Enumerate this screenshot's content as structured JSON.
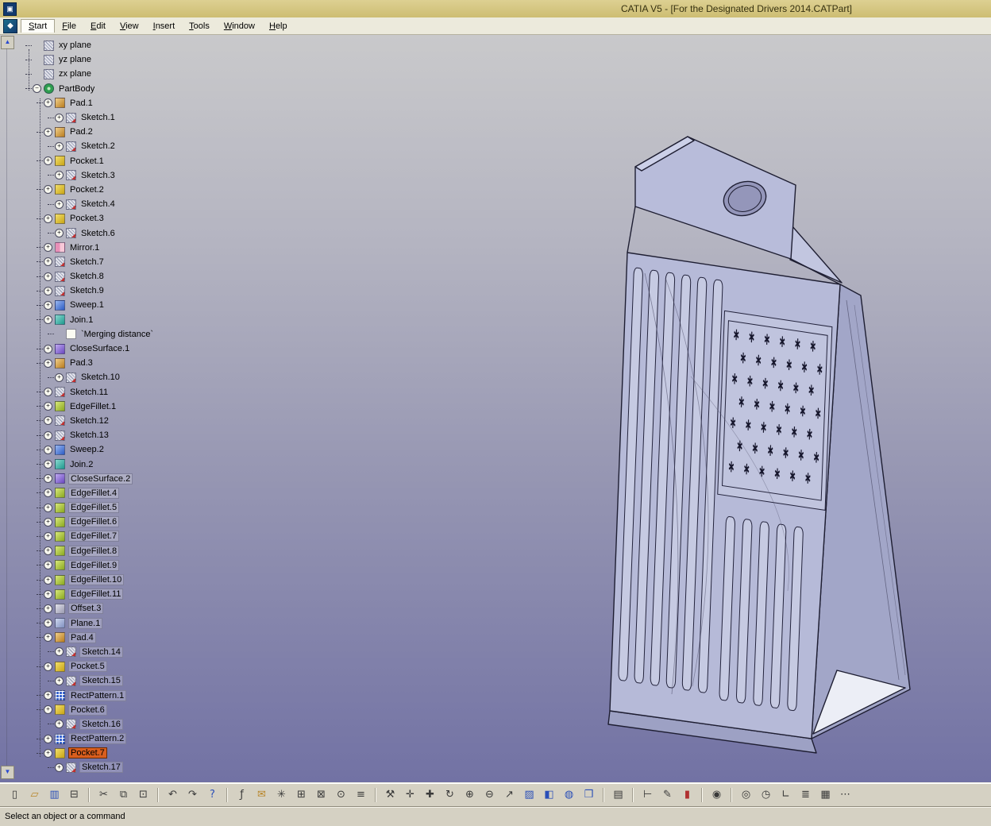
{
  "window": {
    "title": "CATIA V5 - [For the Designated Drivers 2014.CATPart]"
  },
  "menu": {
    "items": [
      "Start",
      "File",
      "Edit",
      "View",
      "Insert",
      "Tools",
      "Window",
      "Help"
    ]
  },
  "status": {
    "message": "Select an object or a command"
  },
  "colors": {
    "selection": "#d95e1e",
    "titlebar": "#d4c87e",
    "viewport_top": "#c9c9cb",
    "viewport_bottom": "#7272a4",
    "model_fill": "#b6bad8"
  },
  "tree": {
    "items": [
      {
        "label": "xy plane",
        "icon": "plane",
        "level": 1,
        "toggle": "",
        "state": ""
      },
      {
        "label": "yz plane",
        "icon": "plane",
        "level": 1,
        "toggle": "",
        "state": ""
      },
      {
        "label": "zx plane",
        "icon": "plane",
        "level": 1,
        "toggle": "",
        "state": ""
      },
      {
        "label": "PartBody",
        "icon": "partbody",
        "level": 1,
        "toggle": "-",
        "state": ""
      },
      {
        "label": "Pad.1",
        "icon": "pad",
        "level": 2,
        "toggle": "+",
        "state": ""
      },
      {
        "label": "Sketch.1",
        "icon": "sketch",
        "level": 3,
        "toggle": "+",
        "state": ""
      },
      {
        "label": "Pad.2",
        "icon": "pad",
        "level": 2,
        "toggle": "+",
        "state": ""
      },
      {
        "label": "Sketch.2",
        "icon": "sketch",
        "level": 3,
        "toggle": "+",
        "state": ""
      },
      {
        "label": "Pocket.1",
        "icon": "pocket",
        "level": 2,
        "toggle": "+",
        "state": ""
      },
      {
        "label": "Sketch.3",
        "icon": "sketch",
        "level": 3,
        "toggle": "+",
        "state": ""
      },
      {
        "label": "Pocket.2",
        "icon": "pocket",
        "level": 2,
        "toggle": "+",
        "state": ""
      },
      {
        "label": "Sketch.4",
        "icon": "sketch",
        "level": 3,
        "toggle": "+",
        "state": ""
      },
      {
        "label": "Pocket.3",
        "icon": "pocket",
        "level": 2,
        "toggle": "+",
        "state": ""
      },
      {
        "label": "Sketch.6",
        "icon": "sketch",
        "level": 3,
        "toggle": "+",
        "state": ""
      },
      {
        "label": "Mirror.1",
        "icon": "mirror",
        "level": 2,
        "toggle": "+",
        "state": ""
      },
      {
        "label": "Sketch.7",
        "icon": "sketch",
        "level": 2,
        "toggle": "+",
        "state": ""
      },
      {
        "label": "Sketch.8",
        "icon": "sketch",
        "level": 2,
        "toggle": "+",
        "state": ""
      },
      {
        "label": "Sketch.9",
        "icon": "sketch",
        "level": 2,
        "toggle": "+",
        "state": ""
      },
      {
        "label": "Sweep.1",
        "icon": "sweep",
        "level": 2,
        "toggle": "+",
        "state": ""
      },
      {
        "label": "Join.1",
        "icon": "join",
        "level": 2,
        "toggle": "+",
        "state": ""
      },
      {
        "label": "`Merging distance`",
        "icon": "note",
        "level": 3,
        "toggle": "",
        "state": ""
      },
      {
        "label": "CloseSurface.1",
        "icon": "closesurface",
        "level": 2,
        "toggle": "+",
        "state": ""
      },
      {
        "label": "Pad.3",
        "icon": "pad",
        "level": 2,
        "toggle": "+",
        "state": ""
      },
      {
        "label": "Sketch.10",
        "icon": "sketch",
        "level": 3,
        "toggle": "+",
        "state": ""
      },
      {
        "label": "Sketch.11",
        "icon": "sketch",
        "level": 2,
        "toggle": "+",
        "state": ""
      },
      {
        "label": "EdgeFillet.1",
        "icon": "edgefillet",
        "level": 2,
        "toggle": "+",
        "state": ""
      },
      {
        "label": "Sketch.12",
        "icon": "sketch",
        "level": 2,
        "toggle": "+",
        "state": ""
      },
      {
        "label": "Sketch.13",
        "icon": "sketch",
        "level": 2,
        "toggle": "+",
        "state": ""
      },
      {
        "label": "Sweep.2",
        "icon": "sweep",
        "level": 2,
        "toggle": "+",
        "state": ""
      },
      {
        "label": "Join.2",
        "icon": "join",
        "level": 2,
        "toggle": "+",
        "state": ""
      },
      {
        "label": "CloseSurface.2",
        "icon": "closesurface",
        "level": 2,
        "toggle": "+",
        "state": "boxed"
      },
      {
        "label": "EdgeFillet.4",
        "icon": "edgefillet",
        "level": 2,
        "toggle": "+",
        "state": "boxed"
      },
      {
        "label": "EdgeFillet.5",
        "icon": "edgefillet",
        "level": 2,
        "toggle": "+",
        "state": "boxed"
      },
      {
        "label": "EdgeFillet.6",
        "icon": "edgefillet",
        "level": 2,
        "toggle": "+",
        "state": "boxed"
      },
      {
        "label": "EdgeFillet.7",
        "icon": "edgefillet",
        "level": 2,
        "toggle": "+",
        "state": "boxed"
      },
      {
        "label": "EdgeFillet.8",
        "icon": "edgefillet",
        "level": 2,
        "toggle": "+",
        "state": "boxed"
      },
      {
        "label": "EdgeFillet.9",
        "icon": "edgefillet",
        "level": 2,
        "toggle": "+",
        "state": "boxed"
      },
      {
        "label": "EdgeFillet.10",
        "icon": "edgefillet",
        "level": 2,
        "toggle": "+",
        "state": "boxed"
      },
      {
        "label": "EdgeFillet.11",
        "icon": "edgefillet",
        "level": 2,
        "toggle": "+",
        "state": "boxed"
      },
      {
        "label": "Offset.3",
        "icon": "offset",
        "level": 2,
        "toggle": "+",
        "state": "boxed"
      },
      {
        "label": "Plane.1",
        "icon": "planefeat",
        "level": 2,
        "toggle": "+",
        "state": "boxed"
      },
      {
        "label": "Pad.4",
        "icon": "pad",
        "level": 2,
        "toggle": "+",
        "state": "boxed"
      },
      {
        "label": "Sketch.14",
        "icon": "sketch",
        "level": 3,
        "toggle": "+",
        "state": "boxed"
      },
      {
        "label": "Pocket.5",
        "icon": "pocket",
        "level": 2,
        "toggle": "+",
        "state": "boxed"
      },
      {
        "label": "Sketch.15",
        "icon": "sketch",
        "level": 3,
        "toggle": "+",
        "state": "boxed"
      },
      {
        "label": "RectPattern.1",
        "icon": "rectpattern",
        "level": 2,
        "toggle": "+",
        "state": "boxed"
      },
      {
        "label": "Pocket.6",
        "icon": "pocket",
        "level": 2,
        "toggle": "+",
        "state": "boxed"
      },
      {
        "label": "Sketch.16",
        "icon": "sketch",
        "level": 3,
        "toggle": "+",
        "state": "boxed"
      },
      {
        "label": "RectPattern.2",
        "icon": "rectpattern",
        "level": 2,
        "toggle": "+",
        "state": "boxed"
      },
      {
        "label": "Pocket.7",
        "icon": "pocket",
        "level": 2,
        "toggle": "+",
        "state": "selected"
      },
      {
        "label": "Sketch.17",
        "icon": "sketch",
        "level": 3,
        "toggle": "+",
        "state": "boxed"
      }
    ]
  },
  "toolbar": {
    "icons": [
      {
        "name": "new-document-icon",
        "glyph": "▯",
        "cls": ""
      },
      {
        "name": "open-folder-icon",
        "glyph": "▱",
        "cls": "c-tan"
      },
      {
        "name": "save-icon",
        "glyph": "▥",
        "cls": "c-blue"
      },
      {
        "name": "print-icon",
        "glyph": "⊟",
        "cls": ""
      },
      {
        "name": "separator",
        "glyph": "",
        "cls": "sep"
      },
      {
        "name": "cut-icon",
        "glyph": "✂",
        "cls": ""
      },
      {
        "name": "copy-icon",
        "glyph": "⧉",
        "cls": ""
      },
      {
        "name": "paste-icon",
        "glyph": "⊡",
        "cls": ""
      },
      {
        "name": "separator",
        "glyph": "",
        "cls": "sep"
      },
      {
        "name": "undo-icon",
        "glyph": "↶",
        "cls": ""
      },
      {
        "name": "redo-icon",
        "glyph": "↷",
        "cls": ""
      },
      {
        "name": "help-icon",
        "glyph": "?",
        "cls": "c-blue"
      },
      {
        "name": "separator",
        "glyph": "",
        "cls": "sep"
      },
      {
        "name": "formula-icon",
        "glyph": "ƒ",
        "cls": ""
      },
      {
        "name": "comment-icon",
        "glyph": "✉",
        "cls": "c-tan"
      },
      {
        "name": "knowledge-icon",
        "glyph": "✳",
        "cls": ""
      },
      {
        "name": "design-table-icon",
        "glyph": "⊞",
        "cls": ""
      },
      {
        "name": "pattern-grid-icon",
        "glyph": "⊠",
        "cls": ""
      },
      {
        "name": "lock-icon",
        "glyph": "⊙",
        "cls": ""
      },
      {
        "name": "constraints-icon",
        "glyph": "≡",
        "cls": ""
      },
      {
        "name": "separator",
        "glyph": "",
        "cls": "sep"
      },
      {
        "name": "wrench-icon",
        "glyph": "⚒",
        "cls": ""
      },
      {
        "name": "snap-icon",
        "glyph": "✛",
        "cls": ""
      },
      {
        "name": "move-icon",
        "glyph": "✚",
        "cls": ""
      },
      {
        "name": "rotate-icon",
        "glyph": "↻",
        "cls": ""
      },
      {
        "name": "zoom-in-icon",
        "glyph": "⊕",
        "cls": ""
      },
      {
        "name": "zoom-out-icon",
        "glyph": "⊖",
        "cls": ""
      },
      {
        "name": "fly-icon",
        "glyph": "↗",
        "cls": ""
      },
      {
        "name": "normal-view-icon",
        "glyph": "▨",
        "cls": "c-blue"
      },
      {
        "name": "iso-view-icon",
        "glyph": "◧",
        "cls": "c-blue"
      },
      {
        "name": "render-style-icon",
        "glyph": "◍",
        "cls": "c-blue"
      },
      {
        "name": "multi-view-icon",
        "glyph": "❒",
        "cls": "c-blue"
      },
      {
        "name": "separator",
        "glyph": "",
        "cls": "sep"
      },
      {
        "name": "print-preview-icon",
        "glyph": "▤",
        "cls": ""
      },
      {
        "name": "separator",
        "glyph": "",
        "cls": "sep"
      },
      {
        "name": "measure-icon",
        "glyph": "⊢",
        "cls": ""
      },
      {
        "name": "annotation-icon",
        "glyph": "✎",
        "cls": ""
      },
      {
        "name": "material-icon",
        "glyph": "▮",
        "cls": "c-red"
      },
      {
        "name": "separator",
        "glyph": "",
        "cls": "sep"
      },
      {
        "name": "capture-icon",
        "glyph": "◉",
        "cls": ""
      },
      {
        "name": "separator",
        "glyph": "",
        "cls": "sep"
      },
      {
        "name": "globe-icon",
        "glyph": "◎",
        "cls": ""
      },
      {
        "name": "clock-icon",
        "glyph": "◷",
        "cls": ""
      },
      {
        "name": "axis-icon",
        "glyph": "∟",
        "cls": ""
      },
      {
        "name": "sort-icon",
        "glyph": "≣",
        "cls": ""
      },
      {
        "name": "grid-icon",
        "glyph": "▦",
        "cls": ""
      },
      {
        "name": "options-icon",
        "glyph": "⋯",
        "cls": ""
      }
    ]
  }
}
